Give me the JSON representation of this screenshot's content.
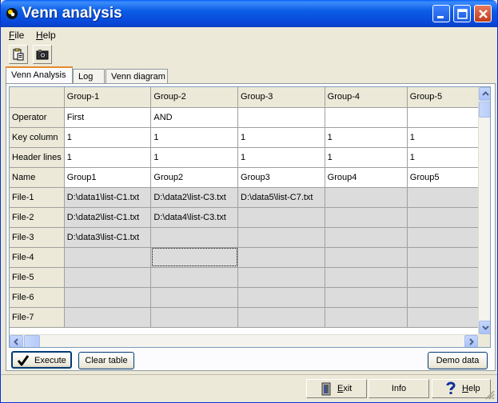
{
  "window": {
    "title": "Venn analysis"
  },
  "menu": [
    {
      "label": "File",
      "mnemonic": "F",
      "rest": "ile"
    },
    {
      "label": "Help",
      "mnemonic": "H",
      "rest": "elp"
    }
  ],
  "toolbar": {
    "icons": [
      "clipboard-paste-icon",
      "camera-icon"
    ]
  },
  "tabs": [
    {
      "label": "Venn Analysis",
      "active": true
    },
    {
      "label": "Log",
      "active": false
    },
    {
      "label": "Venn diagram",
      "active": false
    }
  ],
  "grid": {
    "columns": [
      "",
      "Group-1",
      "Group-2",
      "Group-3",
      "Group-4",
      "Group-5"
    ],
    "rows": [
      {
        "label": "Operator",
        "cells": [
          "First",
          "AND",
          "",
          "",
          ""
        ]
      },
      {
        "label": "Key column",
        "cells": [
          "1",
          "1",
          "1",
          "1",
          "1"
        ]
      },
      {
        "label": "Header lines",
        "cells": [
          "1",
          "1",
          "1",
          "1",
          "1"
        ]
      },
      {
        "label": "Name",
        "cells": [
          "Group1",
          "Group2",
          "Group3",
          "Group4",
          "Group5"
        ]
      },
      {
        "label": "File-1",
        "cells": [
          "D:\\data1\\list-C1.txt",
          "D:\\data2\\list-C3.txt",
          "D:\\data5\\list-C7.txt",
          "",
          ""
        ]
      },
      {
        "label": "File-2",
        "cells": [
          "D:\\data2\\list-C1.txt",
          "D:\\data4\\list-C3.txt",
          "",
          "",
          ""
        ]
      },
      {
        "label": "File-3",
        "cells": [
          "D:\\data3\\list-C1.txt",
          "",
          "",
          "",
          ""
        ]
      },
      {
        "label": "File-4",
        "cells": [
          "",
          "",
          "",
          "",
          ""
        ]
      },
      {
        "label": "File-5",
        "cells": [
          "",
          "",
          "",
          "",
          ""
        ]
      },
      {
        "label": "File-6",
        "cells": [
          "",
          "",
          "",
          "",
          ""
        ]
      },
      {
        "label": "File-7",
        "cells": [
          "",
          "",
          "",
          "",
          ""
        ]
      }
    ]
  },
  "actions": {
    "execute": "Execute",
    "clear_table": "Clear table",
    "demo_data": "Demo data"
  },
  "bottom": {
    "exit": {
      "mnemonic": "E",
      "rest": "xit"
    },
    "info": {
      "label": "Info"
    },
    "help": {
      "mnemonic": "H",
      "rest": "elp"
    }
  }
}
